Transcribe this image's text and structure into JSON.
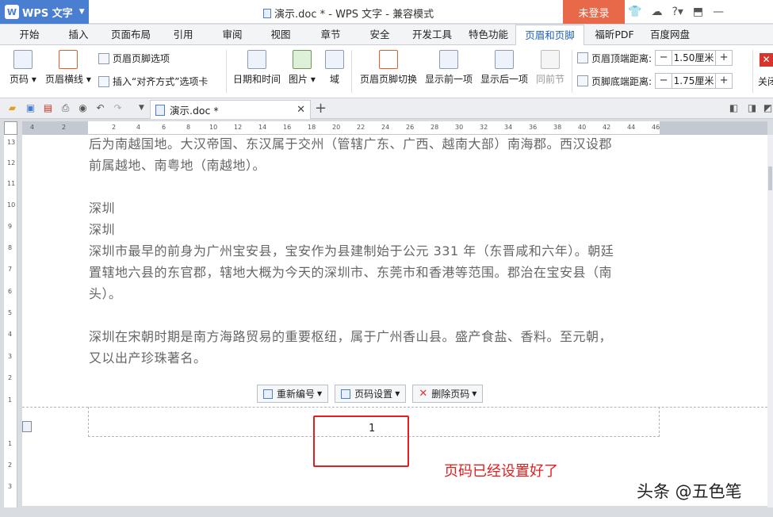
{
  "app": {
    "name": "WPS 文字",
    "logo_glyph": "W",
    "doc_title": "演示.doc * - WPS 文字 - 兼容模式",
    "login": "未登录",
    "help": "?"
  },
  "menu": [
    "开始",
    "插入",
    "页面布局",
    "引用",
    "审阅",
    "视图",
    "章节",
    "安全",
    "开发工具",
    "特色功能",
    "页眉和页脚",
    "福昕PDF",
    "百度网盘"
  ],
  "ribbon": {
    "page_number": "页码",
    "header_line": "页眉横线",
    "header_footer_options": "页眉页脚选项",
    "insert_align_tab": "插入“对齐方式”选项卡",
    "date_time": "日期和时间",
    "picture": "图片",
    "field": "域",
    "switch": "页眉页脚切换",
    "show_prev": "显示前一项",
    "show_next": "显示后一项",
    "same_as_prev": "同前节",
    "header_top_label": "页眉顶端距离:",
    "header_top_value": "1.50厘米",
    "footer_bottom_label": "页脚底端距离:",
    "footer_bottom_value": "1.75厘米",
    "close": "关闭"
  },
  "tab": {
    "name": "演示.doc *"
  },
  "ruler_h": [
    "4",
    "2",
    "2",
    "4",
    "6",
    "8",
    "10",
    "12",
    "14",
    "16",
    "18",
    "20",
    "22",
    "24",
    "26",
    "28",
    "30",
    "32",
    "34",
    "36",
    "38",
    "40",
    "42",
    "44",
    "46"
  ],
  "ruler_v": [
    "13",
    "12",
    "11",
    "10",
    "9",
    "8",
    "7",
    "6",
    "5",
    "4",
    "3",
    "2",
    "1",
    "1",
    "2",
    "3"
  ],
  "doc": {
    "lines": [
      "后为南越国地。大汉帝国、东汉属于交州（管辖广东、广西、越南大部）南海郡。西汉设郡",
      "前属越地、南粤地（南越地）。",
      "",
      "深圳",
      "深圳",
      "深圳市最早的前身为广州宝安县，宝安作为县建制始于公元 331 年（东晋咸和六年）。朝廷",
      "置辖地六县的东官郡，辖地大概为今天的深圳市、东莞市和香港等范围。郡治在宝安县（南",
      "头）。",
      "",
      "深圳在宋朝时期是南方海路贸易的重要枢纽，属于广州香山县。盛产食盐、香料。至元朝，",
      "又以出产珍珠著名。"
    ],
    "footer_tools": {
      "renumber": "重新编号",
      "page_setup": "页码设置",
      "delete": "删除页码"
    },
    "page_number": "1",
    "annotation": "页码已经设置好了",
    "watermark": "头条 @五色笔"
  },
  "colors": {
    "accent": "#4a7ed0",
    "login": "#e8684a",
    "annotation": "#e02020",
    "active_tab_text": "#1c5fbd"
  }
}
